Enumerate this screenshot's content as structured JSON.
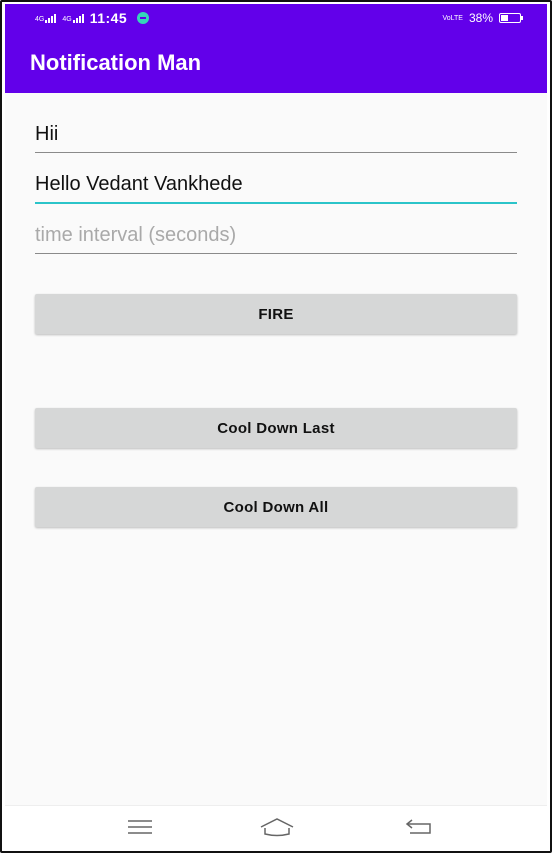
{
  "status_bar": {
    "network1": "4G",
    "network2": "4G",
    "time": "11:45",
    "volte": "VoLTE",
    "battery_text": "38%",
    "battery_level": 0.38,
    "icons": [
      "signal-icon",
      "signal-icon",
      "message-icon",
      "volte-icon",
      "battery-icon"
    ]
  },
  "app_bar": {
    "title": "Notification Man"
  },
  "form": {
    "title_value": "Hii",
    "message_value": "Hello Vedant Vankhede",
    "interval_placeholder": "time interval (seconds)"
  },
  "buttons": {
    "fire": "FIRE",
    "cool_down_last": "Cool Down Last",
    "cool_down_all": "Cool Down All"
  },
  "nav": {
    "icons": [
      "menu-icon",
      "home-icon",
      "back-icon"
    ]
  },
  "colors": {
    "primary": "#6200ea",
    "accent": "#2bc4c9",
    "button_bg": "#d6d7d7"
  }
}
